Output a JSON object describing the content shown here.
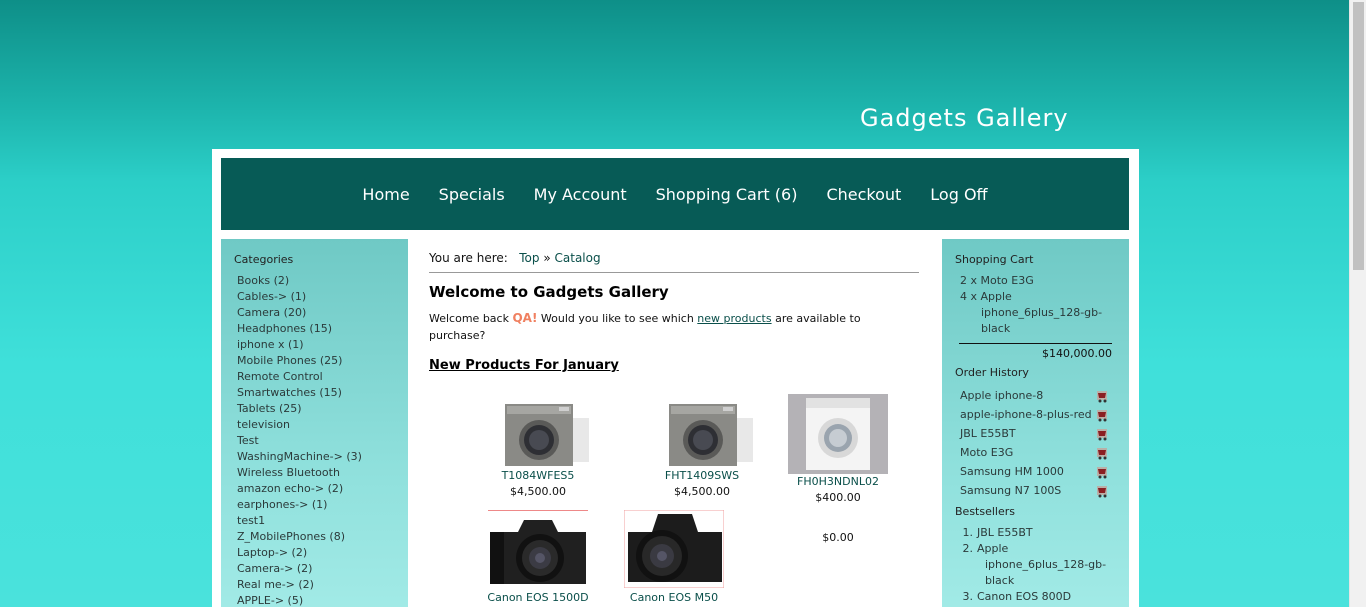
{
  "header": {
    "site_title": "Gadgets Gallery"
  },
  "nav": {
    "items": [
      "Home",
      "Specials",
      "My Account",
      "Shopping Cart (6)",
      "Checkout",
      "Log Off"
    ]
  },
  "categories": {
    "heading": "Categories",
    "items": [
      "Books (2)",
      "Cables-> (1)",
      "Camera (20)",
      "Headphones (15)",
      "iphone x (1)",
      "Mobile Phones (25)",
      "Remote Control",
      "Smartwatches (15)",
      "Tablets (25)",
      "television",
      "Test",
      "WashingMachine-> (3)",
      "Wireless Bluetooth",
      "amazon echo-> (2)",
      "earphones-> (1)",
      "test1",
      "Z_MobilePhones (8)",
      "Laptop-> (2)",
      "Camera-> (2)",
      "Real me-> (2)",
      "APPLE-> (5)"
    ]
  },
  "breadcrumb": {
    "prefix": "You are here:",
    "top": "Top",
    "sep": "»",
    "current": "Catalog"
  },
  "welcome": {
    "title": "Welcome to Gadgets Gallery",
    "text_before": "Welcome back ",
    "user": "QA!",
    "text_middle": " Would you like to see which ",
    "link": "new products",
    "text_after": " are available to purchase?"
  },
  "new_products": {
    "heading": "New Products For January",
    "items": [
      {
        "name": "T1084WFES5",
        "price": "$4,500.00"
      },
      {
        "name": "FHT1409SWS",
        "price": "$4,500.00"
      },
      {
        "name": "FH0H3NDNL02",
        "price": "$400.00"
      },
      {
        "name": "Canon EOS 1500D",
        "price": ""
      },
      {
        "name": "Canon EOS M50",
        "price": ""
      },
      {
        "name": "",
        "price": "$0.00"
      }
    ]
  },
  "shopping_cart": {
    "heading": "Shopping Cart",
    "line1": "2 x Moto E3G",
    "line2a": "4 x Apple",
    "line2b": "iphone_6plus_128-gb-",
    "line2c": "black",
    "total": "$140,000.00"
  },
  "order_history": {
    "heading": "Order History",
    "items": [
      "Apple iphone-8",
      "apple-iphone-8-plus-red",
      "JBL E55BT",
      "Moto E3G",
      "Samsung HM 1000",
      "Samsung N7 100S"
    ]
  },
  "bestsellers": {
    "heading": "Bestsellers",
    "n1": "1.",
    "b1": "JBL E55BT",
    "n2": "2.",
    "b2a": "Apple",
    "b2b": "iphone_6plus_128-gb-",
    "b2c": "black",
    "n3": "3.",
    "b3": "Canon EOS 800D"
  },
  "colors": {
    "nav_bg": "#075b56",
    "link": "#0a4f4a",
    "qa_name": "#f08060"
  }
}
